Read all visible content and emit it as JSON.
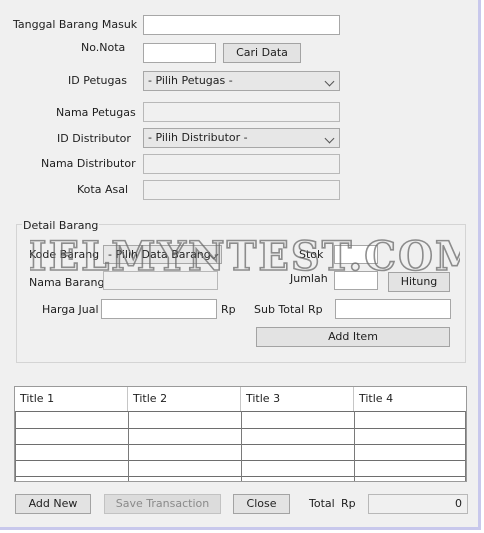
{
  "form": {
    "tanggal_label": "Tanggal Barang Masuk",
    "nota_label": "No.Nota",
    "cari_button": "Cari Data",
    "id_petugas_label": "ID Petugas",
    "petugas_select": "- Pilih Petugas -",
    "nama_petugas_label": "Nama Petugas",
    "id_distributor_label": "ID Distributor",
    "distributor_select": "- Pilih Distributor -",
    "nama_distributor_label": "Nama Distributor",
    "kota_asal_label": "Kota Asal"
  },
  "detail": {
    "group_title": "Detail Barang",
    "kode_barang_label": "Kode Barang",
    "barang_select": "- Pilih Data Barang -",
    "stok_label": "Stok",
    "nama_barang_label": "Nama Barang",
    "jumlah_label": "Jumlah",
    "hitung_button": "Hitung",
    "harga_jual_label": "Harga Jual",
    "harga_unit": "Rp",
    "subtotal_label": "Sub Total",
    "subtotal_unit": "Rp",
    "add_item_button": "Add Item"
  },
  "watermark": "HELMYNTEST.COM",
  "table": {
    "columns": [
      "Title 1",
      "Title 2",
      "Title 3",
      "Title 4"
    ],
    "rows": [
      [
        "",
        "",
        "",
        ""
      ],
      [
        "",
        "",
        "",
        ""
      ],
      [
        "",
        "",
        "",
        ""
      ],
      [
        "",
        "",
        "",
        ""
      ]
    ]
  },
  "footer": {
    "add_new_button": "Add New",
    "save_button": "Save Transaction",
    "close_button": "Close",
    "total_label": "Total",
    "total_unit": "Rp",
    "total_value": "0"
  }
}
